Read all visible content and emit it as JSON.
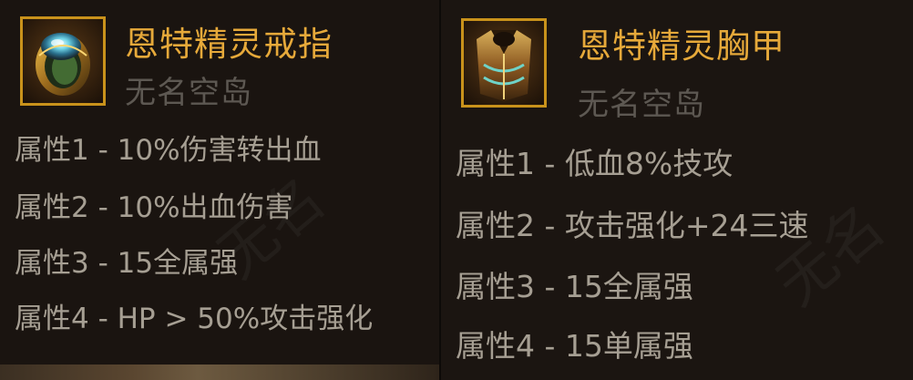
{
  "left_item": {
    "name": "恩特精灵戒指",
    "subtitle": "无名空岛",
    "icon": "ring-icon",
    "attributes": [
      "属性1 - 10%伤害转出血",
      "属性2 - 10%出血伤害",
      "属性3 - 15全属强",
      "属性4 - HP > 50%攻击强化"
    ]
  },
  "right_item": {
    "name": "恩特精灵胸甲",
    "subtitle": "无名空岛",
    "icon": "chest-armor-icon",
    "attributes": [
      "属性1 - 低血8%技攻",
      "属性2 - 攻击强化+24三速",
      "属性3 - 15全属强",
      "属性4 - 15单属强"
    ]
  },
  "bottom_strip_text": "",
  "colors": {
    "name": "#e6a93a",
    "subtitle": "#5d5852",
    "attribute": "#a69f93",
    "frame": "#c9921b",
    "panel_bg": "#1a1410"
  }
}
